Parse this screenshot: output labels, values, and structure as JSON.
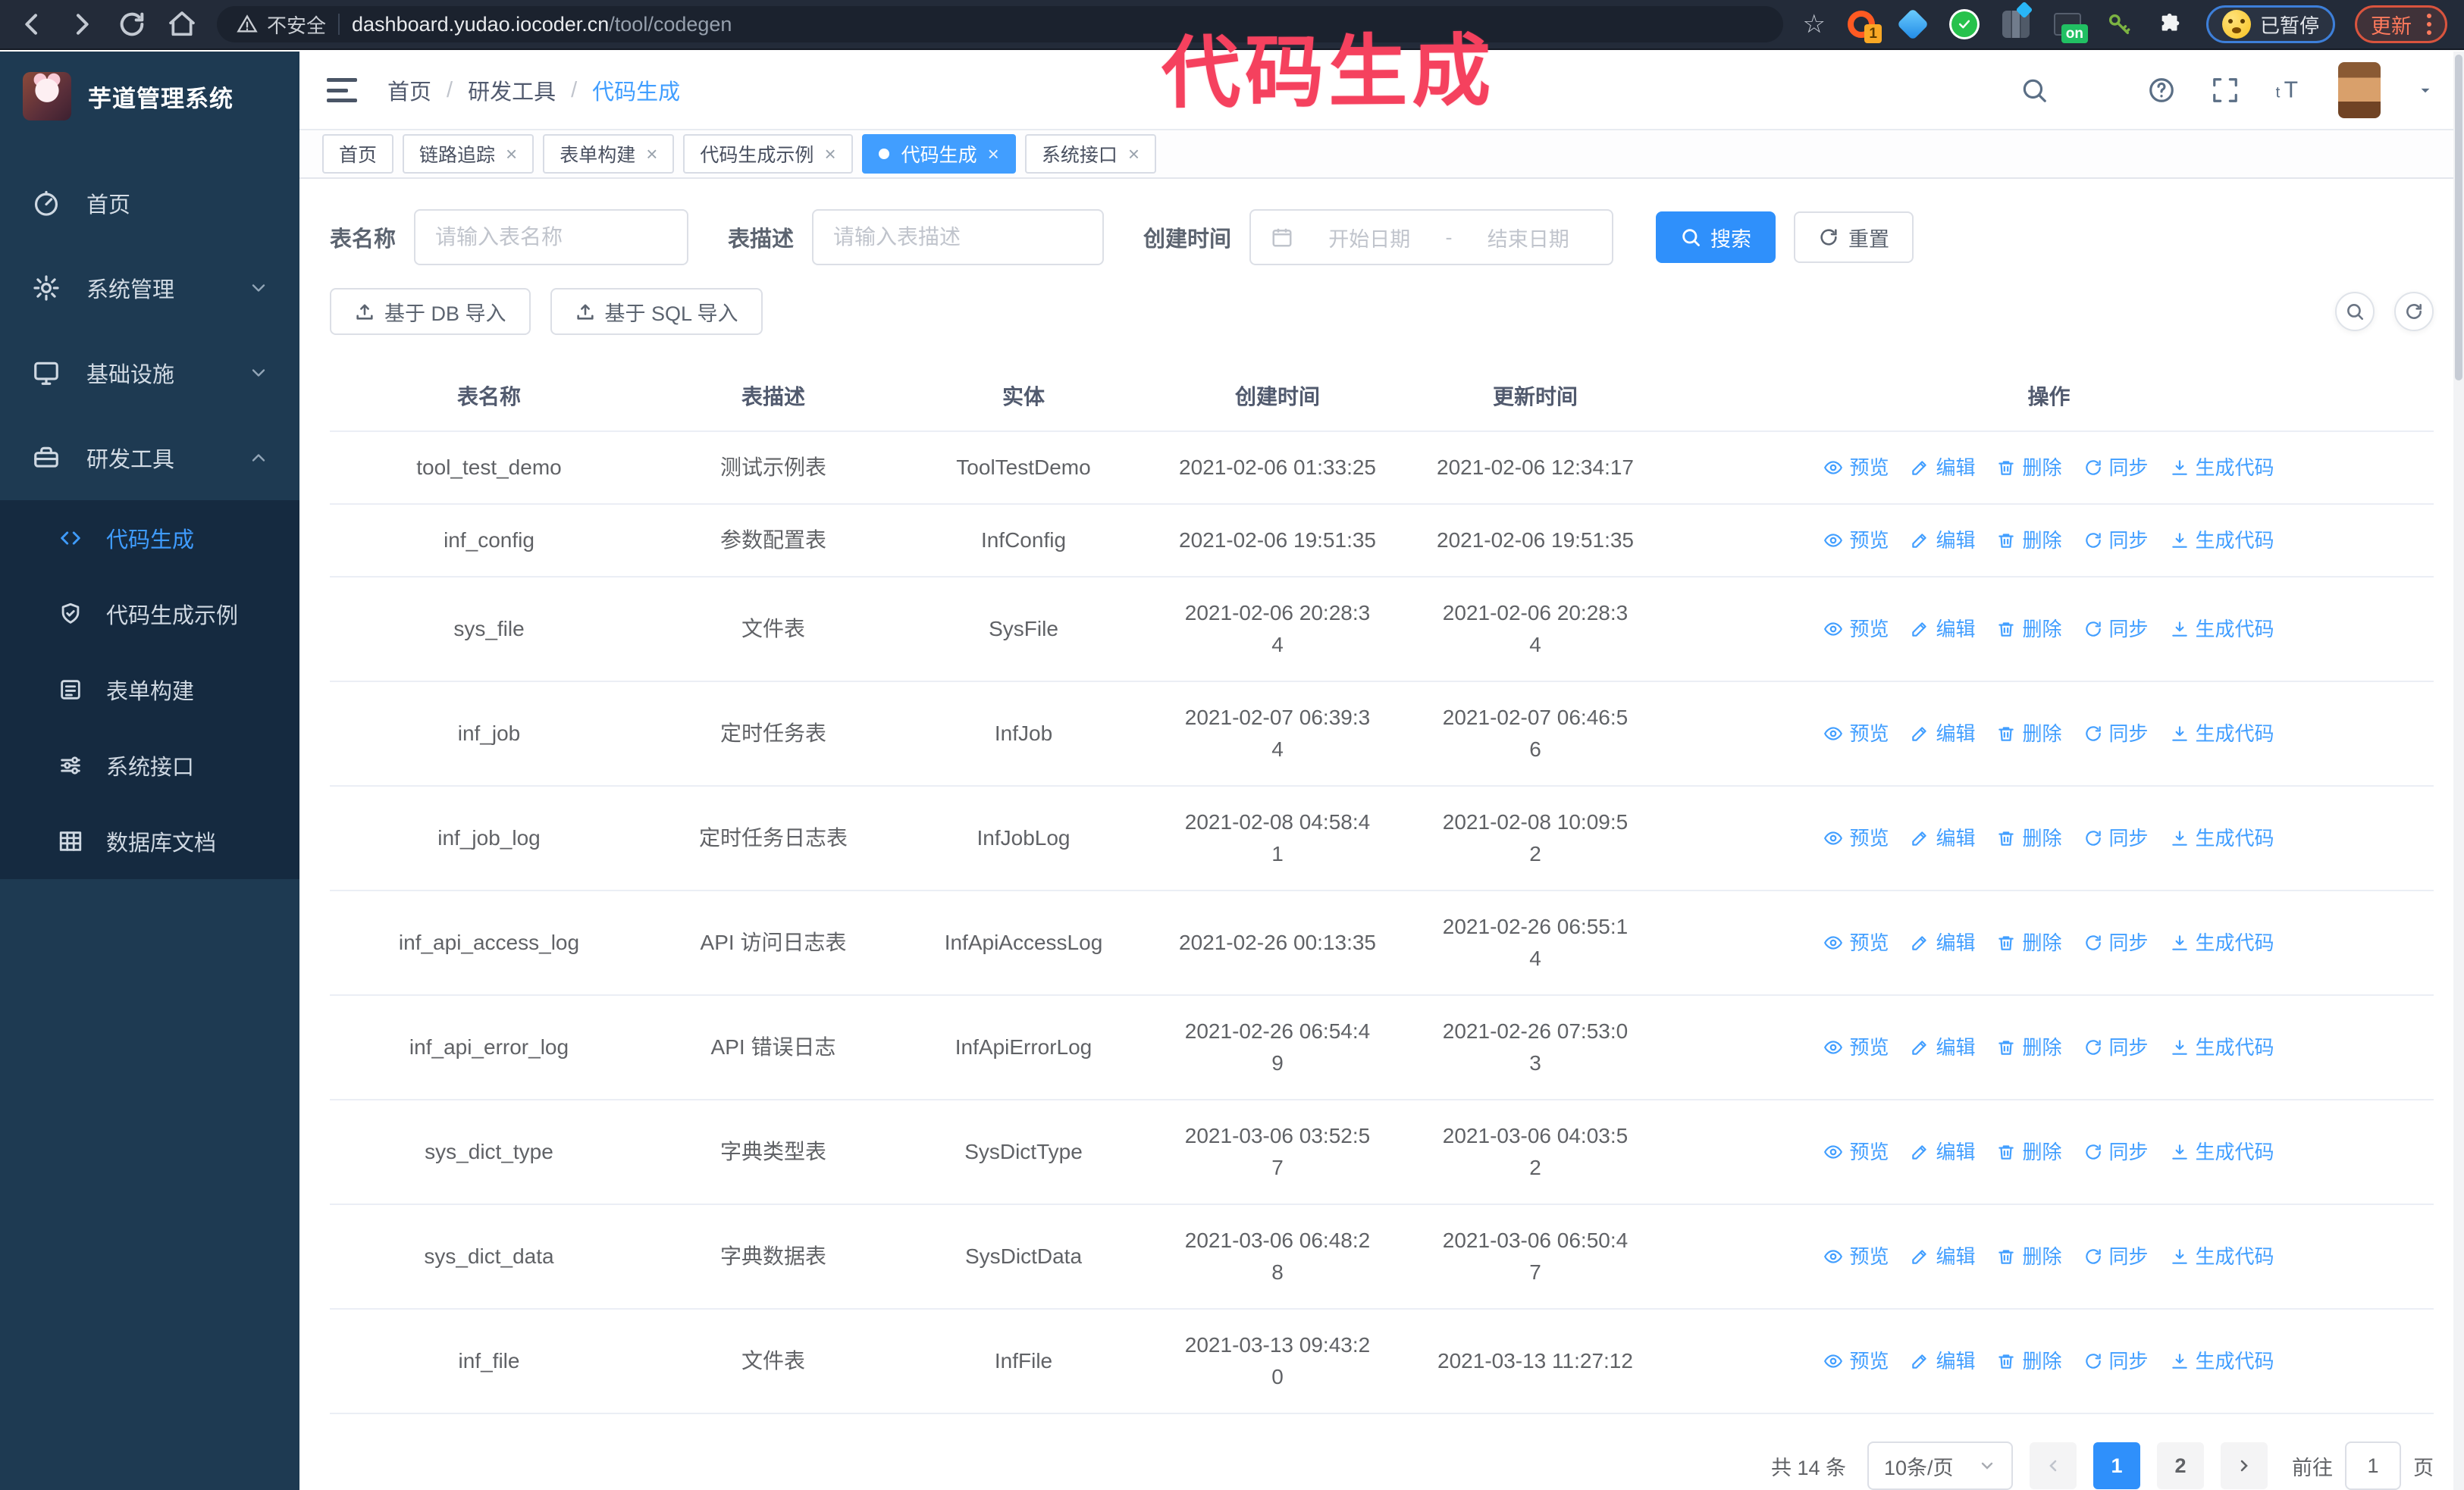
{
  "browser": {
    "security_label": "不安全",
    "url_domain": "dashboard.yudao.iocoder.cn",
    "url_path": "/tool/codegen",
    "extension_badge_count": "1",
    "extension_badge_on": "on",
    "profile_label": "已暂停",
    "update_label": "更新",
    "extensions": [
      "orange-ring-extension",
      "blue-gem-extension",
      "green-check-extension",
      "gray-columns-extension",
      "dark-on-extension",
      "green-key-extension",
      "puzzle-extensions-menu"
    ]
  },
  "watermark": "代码生成",
  "sidebar": {
    "title": "芋道管理系统",
    "items": [
      {
        "label": "首页",
        "icon": "dashboard",
        "chevron": ""
      },
      {
        "label": "系统管理",
        "icon": "gear",
        "chevron": "down"
      },
      {
        "label": "基础设施",
        "icon": "monitor",
        "chevron": "down"
      },
      {
        "label": "研发工具",
        "icon": "toolbox",
        "chevron": "up"
      }
    ],
    "subitems": [
      {
        "label": "代码生成",
        "icon": "code",
        "active": true
      },
      {
        "label": "代码生成示例",
        "icon": "shield",
        "active": false
      },
      {
        "label": "表单构建",
        "icon": "form",
        "active": false
      },
      {
        "label": "系统接口",
        "icon": "sliders",
        "active": false
      },
      {
        "label": "数据库文档",
        "icon": "dbtable",
        "active": false
      }
    ]
  },
  "header": {
    "breadcrumb": [
      "首页",
      "研发工具",
      "代码生成"
    ],
    "separator": "/",
    "right_icons": [
      "search",
      "github",
      "help",
      "fullscreen",
      "fontsize"
    ]
  },
  "tabs": [
    {
      "label": "首页",
      "closable": false,
      "active": false
    },
    {
      "label": "链路追踪",
      "closable": true,
      "active": false
    },
    {
      "label": "表单构建",
      "closable": true,
      "active": false
    },
    {
      "label": "代码生成示例",
      "closable": true,
      "active": false
    },
    {
      "label": "代码生成",
      "closable": true,
      "active": true
    },
    {
      "label": "系统接口",
      "closable": true,
      "active": false
    }
  ],
  "close_glyph": "×",
  "search": {
    "name_label": "表名称",
    "name_placeholder": "请输入表名称",
    "desc_label": "表描述",
    "desc_placeholder": "请输入表描述",
    "time_label": "创建时间",
    "start_placeholder": "开始日期",
    "range_separator": "-",
    "end_placeholder": "结束日期",
    "search_label": "搜索",
    "reset_label": "重置"
  },
  "toolbar": {
    "db_import_label": "基于 DB 导入",
    "sql_import_label": "基于 SQL 导入"
  },
  "table": {
    "columns": [
      "表名称",
      "表描述",
      "实体",
      "创建时间",
      "更新时间",
      "操作"
    ],
    "actions": [
      {
        "label": "预览",
        "icon": "eye"
      },
      {
        "label": "编辑",
        "icon": "edit"
      },
      {
        "label": "删除",
        "icon": "trash"
      },
      {
        "label": "同步",
        "icon": "sync"
      },
      {
        "label": "生成代码",
        "icon": "download"
      }
    ],
    "rows": [
      {
        "name": "tool_test_demo",
        "desc": "测试示例表",
        "entity": "ToolTestDemo",
        "created": "2021-02-06 01:33:25",
        "updated": "2021-02-06 12:34:17"
      },
      {
        "name": "inf_config",
        "desc": "参数配置表",
        "entity": "InfConfig",
        "created": "2021-02-06 19:51:35",
        "updated": "2021-02-06 19:51:35"
      },
      {
        "name": "sys_file",
        "desc": "文件表",
        "entity": "SysFile",
        "created": "2021-02-06 20:28:3\n4",
        "updated": "2021-02-06 20:28:3\n4"
      },
      {
        "name": "inf_job",
        "desc": "定时任务表",
        "entity": "InfJob",
        "created": "2021-02-07 06:39:3\n4",
        "updated": "2021-02-07 06:46:5\n6"
      },
      {
        "name": "inf_job_log",
        "desc": "定时任务日志表",
        "entity": "InfJobLog",
        "created": "2021-02-08 04:58:4\n1",
        "updated": "2021-02-08 10:09:5\n2"
      },
      {
        "name": "inf_api_access_log",
        "desc": "API 访问日志表",
        "entity": "InfApiAccessLog",
        "created": "2021-02-26 00:13:35",
        "updated": "2021-02-26 06:55:1\n4"
      },
      {
        "name": "inf_api_error_log",
        "desc": "API 错误日志",
        "entity": "InfApiErrorLog",
        "created": "2021-02-26 06:54:4\n9",
        "updated": "2021-02-26 07:53:0\n3"
      },
      {
        "name": "sys_dict_type",
        "desc": "字典类型表",
        "entity": "SysDictType",
        "created": "2021-03-06 03:52:5\n7",
        "updated": "2021-03-06 04:03:5\n2"
      },
      {
        "name": "sys_dict_data",
        "desc": "字典数据表",
        "entity": "SysDictData",
        "created": "2021-03-06 06:48:2\n8",
        "updated": "2021-03-06 06:50:4\n7"
      },
      {
        "name": "inf_file",
        "desc": "文件表",
        "entity": "InfFile",
        "created": "2021-03-13 09:43:2\n0",
        "updated": "2021-03-13 11:27:12"
      }
    ]
  },
  "pagination": {
    "total": "共 14 条",
    "page_size": "10条/页",
    "pages": [
      "1",
      "2"
    ],
    "active_page": "1",
    "goto_label": "前往",
    "goto_value": "1",
    "page_unit": "页"
  },
  "colors": {
    "accent_blue": "#419eff",
    "sidebar_bg": "#1e3a52",
    "submenu_bg": "#152a40",
    "watermark_pink": "#f5415e",
    "browser_bar_bg": "#232b39"
  }
}
